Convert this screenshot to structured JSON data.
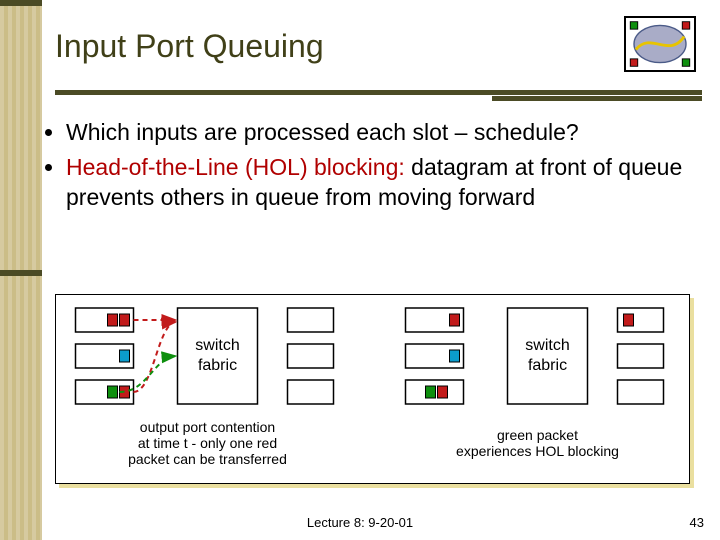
{
  "title": "Input Port Queuing",
  "bullets": [
    {
      "text": "Which inputs are processed each slot – schedule?",
      "plain": true
    },
    {
      "lead": "Head-of-the-Line (HOL) blocking:",
      "rest": " datagram at front of queue prevents others in queue from moving forward"
    }
  ],
  "diagram": {
    "box_label": "switch fabric",
    "caption_left_l1": "output port contention",
    "caption_left_l2": "at  time t - only one red",
    "caption_left_l3": "packet can be transferred",
    "caption_right_l1": "green packet",
    "caption_right_l2": "experiences HOL blocking",
    "colors": {
      "red": "#c21b1b",
      "green": "#0e8f0e",
      "blue": "#0b9ccc"
    }
  },
  "footer": "Lecture 8: 9-20-01",
  "page": "43"
}
